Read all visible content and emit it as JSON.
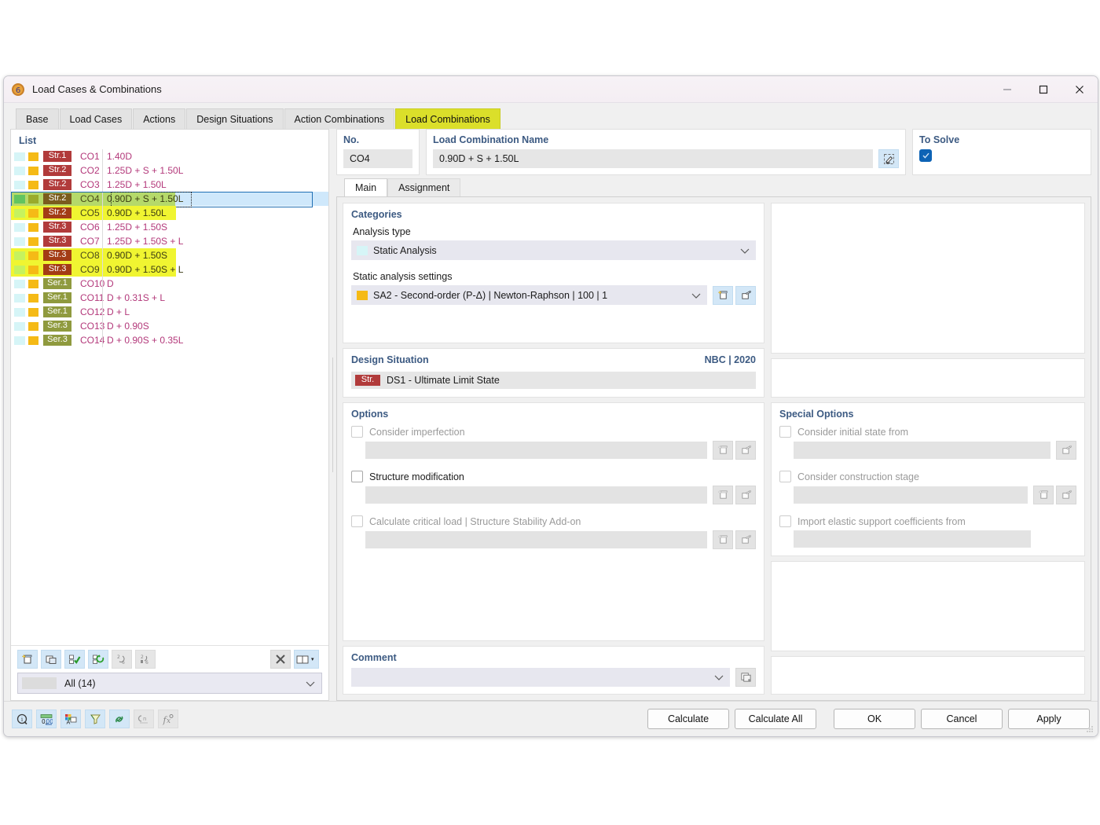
{
  "window": {
    "title": "Load Cases & Combinations",
    "icon": "app-icon",
    "controls": {
      "minimize": "minimize-icon",
      "maximize": "maximize-icon",
      "close": "close-icon"
    }
  },
  "tabs": [
    {
      "label": "Base",
      "active": false
    },
    {
      "label": "Load Cases",
      "active": false
    },
    {
      "label": "Actions",
      "active": false
    },
    {
      "label": "Design Situations",
      "active": false
    },
    {
      "label": "Action Combinations",
      "active": false
    },
    {
      "label": "Load Combinations",
      "active": true
    }
  ],
  "list": {
    "title": "List",
    "rows": [
      {
        "tag": "Str.1",
        "tag_kind": "str",
        "no": "CO1",
        "name": "1.40D",
        "chk_color": "#d6f5f7",
        "clr_color": "#f5ba16",
        "highlight": "none"
      },
      {
        "tag": "Str.2",
        "tag_kind": "str",
        "no": "CO2",
        "name": "1.25D + S + 1.50L",
        "chk_color": "#d6f5f7",
        "clr_color": "#f5ba16",
        "highlight": "none"
      },
      {
        "tag": "Str.2",
        "tag_kind": "str",
        "no": "CO3",
        "name": "1.25D + 1.50L",
        "chk_color": "#d6f5f7",
        "clr_color": "#f5ba16",
        "highlight": "none"
      },
      {
        "tag": "Str.2",
        "tag_kind": "str",
        "no": "CO4",
        "name": "0.90D + S + 1.50L",
        "chk_color": "#62c45f",
        "clr_color": "#9aab2c",
        "highlight": "selected"
      },
      {
        "tag": "Str.2",
        "tag_kind": "str",
        "no": "CO5",
        "name": "0.90D + 1.50L",
        "chk_color": "#c6f25e",
        "clr_color": "#f5ba16",
        "highlight": "yellow"
      },
      {
        "tag": "Str.3",
        "tag_kind": "str",
        "no": "CO6",
        "name": "1.25D + 1.50S",
        "chk_color": "#d6f5f7",
        "clr_color": "#f5ba16",
        "highlight": "none"
      },
      {
        "tag": "Str.3",
        "tag_kind": "str",
        "no": "CO7",
        "name": "1.25D + 1.50S + L",
        "chk_color": "#d6f5f7",
        "clr_color": "#f5ba16",
        "highlight": "none"
      },
      {
        "tag": "Str.3",
        "tag_kind": "str",
        "no": "CO8",
        "name": "0.90D + 1.50S",
        "chk_color": "#c6f25e",
        "clr_color": "#f5ba16",
        "highlight": "yellow"
      },
      {
        "tag": "Str.3",
        "tag_kind": "str",
        "no": "CO9",
        "name": "0.90D + 1.50S + L",
        "chk_color": "#c6f25e",
        "clr_color": "#f5ba16",
        "highlight": "yellow"
      },
      {
        "tag": "Ser.1",
        "tag_kind": "ser",
        "no": "CO10",
        "name": "D",
        "chk_color": "#d6f5f7",
        "clr_color": "#f5ba16",
        "highlight": "none"
      },
      {
        "tag": "Ser.1",
        "tag_kind": "ser",
        "no": "CO11",
        "name": "D + 0.31S + L",
        "chk_color": "#d6f5f7",
        "clr_color": "#f5ba16",
        "highlight": "none"
      },
      {
        "tag": "Ser.1",
        "tag_kind": "ser",
        "no": "CO12",
        "name": "D + L",
        "chk_color": "#d6f5f7",
        "clr_color": "#f5ba16",
        "highlight": "none"
      },
      {
        "tag": "Ser.3",
        "tag_kind": "ser",
        "no": "CO13",
        "name": "D + 0.90S",
        "chk_color": "#d6f5f7",
        "clr_color": "#f5ba16",
        "highlight": "none"
      },
      {
        "tag": "Ser.3",
        "tag_kind": "ser",
        "no": "CO14",
        "name": "D + 0.90S + 0.35L",
        "chk_color": "#d6f5f7",
        "clr_color": "#f5ba16",
        "highlight": "none"
      }
    ],
    "toolbar": [
      {
        "name": "new-item-button",
        "enabled": true
      },
      {
        "name": "copy-item-button",
        "enabled": true
      },
      {
        "name": "select-all-button",
        "enabled": true
      },
      {
        "name": "invert-selection-button",
        "enabled": true
      },
      {
        "name": "renumber-button",
        "enabled": false
      },
      {
        "name": "numbering-button",
        "enabled": false
      },
      {
        "name": "delete-button",
        "enabled": true
      },
      {
        "name": "view-mode-button",
        "enabled": true
      }
    ],
    "filter": {
      "label": "All (14)"
    }
  },
  "detail": {
    "no": {
      "label": "No.",
      "value": "CO4"
    },
    "name": {
      "label": "Load Combination Name",
      "value": "0.90D + S + 1.50L",
      "edit_icon": "edit-pencil-icon"
    },
    "to_solve": {
      "label": "To Solve",
      "checked": true
    },
    "inner_tabs": [
      {
        "label": "Main",
        "active": true
      },
      {
        "label": "Assignment",
        "active": false
      }
    ],
    "categories": {
      "title": "Categories",
      "analysis_type": {
        "label": "Analysis type",
        "value": "Static Analysis",
        "swatch": "#d6f5f7"
      },
      "static_settings": {
        "label": "Static analysis settings",
        "value": "SA2 - Second-order (P-Δ) | Newton-Raphson | 100 | 1",
        "swatch": "#f5ba16",
        "buttons": [
          {
            "name": "new-static-settings-button"
          },
          {
            "name": "edit-static-settings-button"
          }
        ]
      }
    },
    "design_situation": {
      "title": "Design Situation",
      "standard": "NBC | 2020",
      "tag": "Str.",
      "value": "DS1 - Ultimate Limit State"
    },
    "options": {
      "title": "Options",
      "items": [
        {
          "label": "Consider imperfection",
          "checked": false,
          "dimmed": true,
          "buttons": [
            {
              "name": "new-imperfection-button"
            },
            {
              "name": "edit-imperfection-button"
            }
          ]
        },
        {
          "label": "Structure modification",
          "checked": false,
          "dimmed": false,
          "buttons": [
            {
              "name": "new-structure-modification-button"
            },
            {
              "name": "edit-structure-modification-button"
            }
          ]
        },
        {
          "label": "Calculate critical load | Structure Stability Add-on",
          "checked": false,
          "dimmed": true,
          "buttons": [
            {
              "name": "new-critical-load-button"
            },
            {
              "name": "edit-critical-load-button"
            }
          ]
        }
      ]
    },
    "special_options": {
      "title": "Special Options",
      "items": [
        {
          "label": "Consider initial state from",
          "checked": false,
          "dimmed": true,
          "buttons": [
            {
              "name": "edit-initial-state-button"
            }
          ]
        },
        {
          "label": "Consider construction stage",
          "checked": false,
          "dimmed": true,
          "buttons": [
            {
              "name": "new-construction-stage-button"
            },
            {
              "name": "edit-construction-stage-button"
            }
          ]
        },
        {
          "label": "Import elastic support coefficients from",
          "checked": false,
          "dimmed": true,
          "buttons": []
        }
      ]
    },
    "comment": {
      "title": "Comment",
      "value": "",
      "copy_icon": "copy-icon"
    }
  },
  "footer": {
    "tools": [
      {
        "name": "info-icon",
        "enabled": true
      },
      {
        "name": "units-icon",
        "enabled": true
      },
      {
        "name": "display-properties-icon",
        "enabled": true
      },
      {
        "name": "filter-icon",
        "enabled": true
      },
      {
        "name": "link-icon",
        "enabled": true
      },
      {
        "name": "relations-icon",
        "enabled": false
      },
      {
        "name": "formula-icon",
        "enabled": false
      }
    ],
    "buttons": [
      {
        "label": "Calculate",
        "name": "calculate-button"
      },
      {
        "label": "Calculate All",
        "name": "calculate-all-button"
      },
      {
        "label": "OK",
        "name": "ok-button"
      },
      {
        "label": "Cancel",
        "name": "cancel-button"
      },
      {
        "label": "Apply",
        "name": "apply-button"
      }
    ]
  }
}
